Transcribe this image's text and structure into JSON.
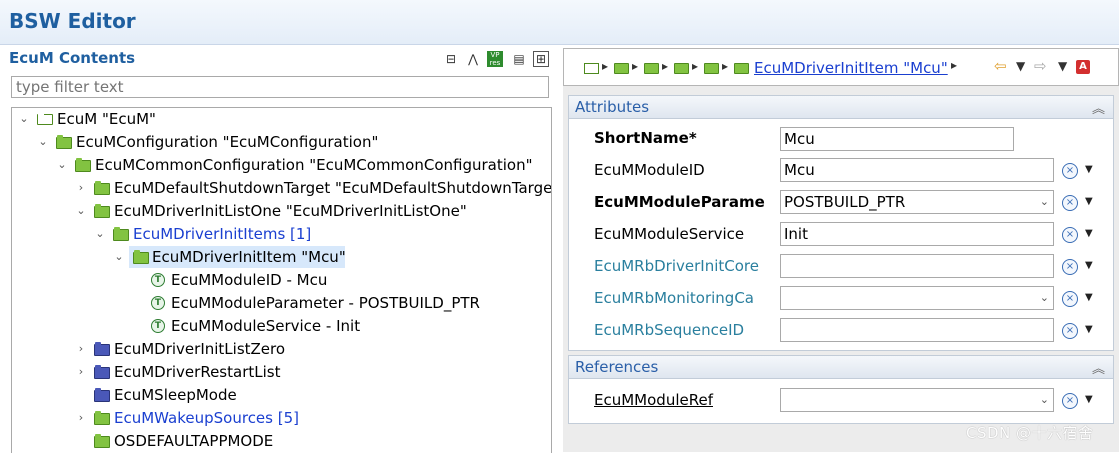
{
  "window": {
    "title": "BSW Editor"
  },
  "left_pane": {
    "title": "EcuM Contents",
    "toolbar_icons": [
      "collapse-all-icon",
      "link-icon",
      "vp-res-icon",
      "document-icon",
      "grid-icon"
    ],
    "filter": {
      "placeholder": "type filter text",
      "value": ""
    },
    "tree": [
      {
        "label": "EcuM \"EcuM\"",
        "icon": "module-root-icon",
        "expand": "open"
      },
      {
        "label": "EcuMConfiguration \"EcuMConfiguration\"",
        "icon": "folder-green-icon",
        "expand": "open"
      },
      {
        "label": "EcuMCommonConfiguration \"EcuMCommonConfiguration\"",
        "icon": "folder-green-icon",
        "expand": "open"
      },
      {
        "label": "EcuMDefaultShutdownTarget \"EcuMDefaultShutdownTarget\"",
        "icon": "folder-green-icon",
        "expand": "closed"
      },
      {
        "label": "EcuMDriverInitListOne \"EcuMDriverInitListOne\"",
        "icon": "folder-green-icon",
        "expand": "open"
      },
      {
        "label": "EcuMDriverInitItems [1]",
        "icon": "folder-green-icon",
        "expand": "open",
        "color": "blue"
      },
      {
        "label": "EcuMDriverInitItem \"Mcu\"",
        "icon": "folder-green-icon",
        "expand": "open",
        "selected": true
      },
      {
        "label": "EcuMModuleID - Mcu",
        "icon": "text-parameter-icon"
      },
      {
        "label": "EcuMModuleParameter - POSTBUILD_PTR",
        "icon": "text-parameter-icon"
      },
      {
        "label": "EcuMModuleService - Init",
        "icon": "text-parameter-icon"
      },
      {
        "label": "EcuMDriverInitListZero",
        "icon": "folder-blue-icon",
        "expand": "closed"
      },
      {
        "label": "EcuMDriverRestartList",
        "icon": "folder-blue-icon",
        "expand": "closed"
      },
      {
        "label": "EcuMSleepMode",
        "icon": "folder-blue-icon"
      },
      {
        "label": "EcuMWakeupSources [5]",
        "icon": "folder-green-icon",
        "expand": "closed",
        "color": "blue"
      },
      {
        "label": "OSDEFAULTAPPMODE",
        "icon": "reference-icon"
      }
    ]
  },
  "right_pane": {
    "breadcrumb": {
      "current": "EcuMDriverInitItem \"Mcu\""
    },
    "nav_icons": [
      "back-arrow-icon",
      "forward-arrow-icon",
      "autosar-icon"
    ],
    "attributes": {
      "title": "Attributes",
      "rows": [
        {
          "label": "ShortName*",
          "value": "Mcu",
          "style": "bold",
          "type": "text"
        },
        {
          "label": "EcuMModuleID",
          "value": "Mcu",
          "style": "normal",
          "type": "text"
        },
        {
          "label": "EcuMModuleParame",
          "value": "POSTBUILD_PTR",
          "style": "bold",
          "type": "select"
        },
        {
          "label": "EcuMModuleService",
          "value": "Init",
          "style": "normal",
          "type": "text"
        },
        {
          "label": "EcuMRbDriverInitCore",
          "value": "",
          "style": "teal",
          "type": "text"
        },
        {
          "label": "EcuMRbMonitoringCa",
          "value": "",
          "style": "teal",
          "type": "select"
        },
        {
          "label": "EcuMRbSequenceID",
          "value": "",
          "style": "teal",
          "type": "text"
        }
      ]
    },
    "references": {
      "title": "References",
      "rows": [
        {
          "label": "EcuMModuleRef",
          "value": "",
          "style": "underline",
          "type": "select"
        }
      ]
    }
  },
  "watermark": "CSDN @十六宿舍",
  "colors": {
    "title_blue": "#1f5fa0",
    "link_blue": "#1a3fd0",
    "teal": "#2a7f9e",
    "selection": "#d7e8fb"
  }
}
